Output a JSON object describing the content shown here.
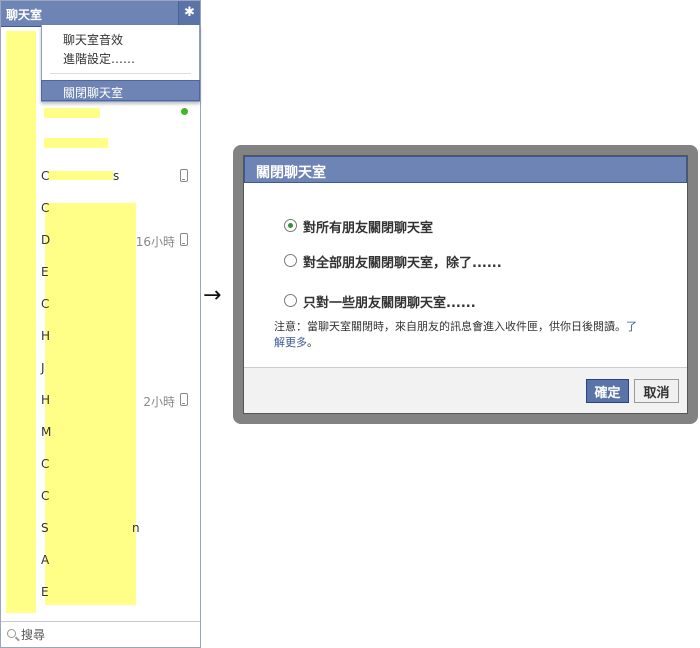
{
  "sidebar": {
    "title": "聊天室",
    "settings_icon": "gear-icon",
    "menu": {
      "sound_label": "聊天室音效",
      "advanced_label": "進階設定……",
      "close_label": "關閉聊天室"
    },
    "rows": [
      {
        "initial": "",
        "tail": "",
        "time": "",
        "status": "online"
      },
      {
        "initial": "",
        "tail": "",
        "time": "",
        "status": ""
      },
      {
        "initial": "C",
        "tail": "s",
        "time": "",
        "status": "mobile"
      },
      {
        "initial": "C",
        "tail": "",
        "time": "",
        "status": ""
      },
      {
        "initial": "D",
        "tail": "",
        "time": "16小時",
        "status": "mobile"
      },
      {
        "initial": "E",
        "tail": "",
        "time": "",
        "status": ""
      },
      {
        "initial": "C",
        "tail": "",
        "time": "",
        "status": ""
      },
      {
        "initial": "H",
        "tail": "",
        "time": "",
        "status": ""
      },
      {
        "initial": "J",
        "tail": "",
        "time": "",
        "status": ""
      },
      {
        "initial": "H",
        "tail": "",
        "time": "2小時",
        "status": "mobile"
      },
      {
        "initial": "M",
        "tail": "",
        "time": "",
        "status": ""
      },
      {
        "initial": "C",
        "tail": "",
        "time": "",
        "status": ""
      },
      {
        "initial": "C",
        "tail": "",
        "time": "",
        "status": ""
      },
      {
        "initial": "S",
        "tail": "n",
        "time": "",
        "status": ""
      },
      {
        "initial": "A",
        "tail": "",
        "time": "",
        "status": ""
      },
      {
        "initial": "E",
        "tail": "",
        "time": "",
        "status": ""
      }
    ],
    "search_placeholder": "搜尋"
  },
  "arrow": "→",
  "dialog": {
    "title": "關閉聊天室",
    "options": [
      {
        "label": "對所有朋友關閉聊天室",
        "checked": true
      },
      {
        "label": "對全部朋友關閉聊天室，除了......",
        "checked": false
      },
      {
        "label": "只對一些朋友關閉聊天室......",
        "checked": false
      }
    ],
    "note_text": "注意：當聊天室關閉時，來自朋友的訊息會進入收件匣，供你日後閱讀。",
    "note_link": "了解更多",
    "note_end": "。",
    "confirm_label": "確定",
    "cancel_label": "取消"
  },
  "colors": {
    "header_blue": "#6d84b4",
    "highlight_yellow": "#ffff88",
    "online_green": "#42b72a"
  }
}
